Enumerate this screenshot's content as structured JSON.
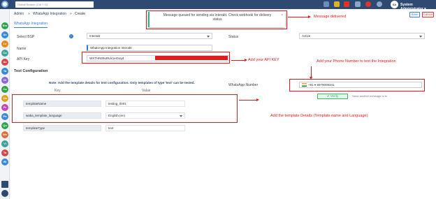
{
  "topbar": {
    "search_placeholder": "Global Search (Ctrl + G)",
    "avatar_initials": "SA",
    "user_name": "System Administrator",
    "user_chevron": "▾"
  },
  "sidebar": {
    "items": [
      "Em",
      "Ac",
      "Le",
      "Co",
      "Ac",
      "Ta",
      "Di",
      "Ca",
      "Ca",
      "Pr",
      "Ph",
      "Qu",
      "We",
      "Vi",
      "Ta",
      "Wi"
    ]
  },
  "breadcrumb": {
    "home": "Admin",
    "sep1": "»",
    "section": "WhatsApp Integration",
    "sep2": "»",
    "current": "Create"
  },
  "actions": {
    "save": "Save",
    "cancel": "Cancel"
  },
  "tab": "WhatsApp Integration",
  "toast": {
    "message": "Message queued for sending via Interakt. Check webhook for delivery status",
    "close": "×"
  },
  "form": {
    "bsp_label": "Select BSP",
    "bsp_value": "Interakt",
    "status_label": "Status",
    "status_value": "Active",
    "name_label": "Name",
    "name_value": "WhatsApp Integration Interakt",
    "apikey_label": "API Key",
    "apikey_value": "WXTHN09uRUk1eGwyd",
    "info_icon": "i"
  },
  "test_config": {
    "section_title": "Test Configuration",
    "note": "Note: Add the template details for test configuration. Only templates of type 'text' can be tested.",
    "key_header": "Key",
    "value_header": "Value",
    "rows": [
      {
        "key": "templateName",
        "value": "testing_0001"
      },
      {
        "key": "waba_template_language",
        "value": "English (en)"
      },
      {
        "key": "templateType",
        "value": "text"
      }
    ],
    "whatsapp_number_label": "WhatsApp Number",
    "country_code": "+91",
    "country_chevron": "▾",
    "phone": "9979009341",
    "verify_label": "Verify",
    "verify_icon": "✔",
    "send_another": "Send another message to ts"
  },
  "annotations": {
    "delivered": "Message delivered",
    "api_key": "Add your API KEY",
    "phone": "Add your Phone Number to test the Integration",
    "template": "Add the template Details (Template name and  Language)"
  },
  "colors": {
    "topbar": "#2f4a70",
    "annotation": "#e01b1b",
    "accent": "#2f7fd3"
  }
}
